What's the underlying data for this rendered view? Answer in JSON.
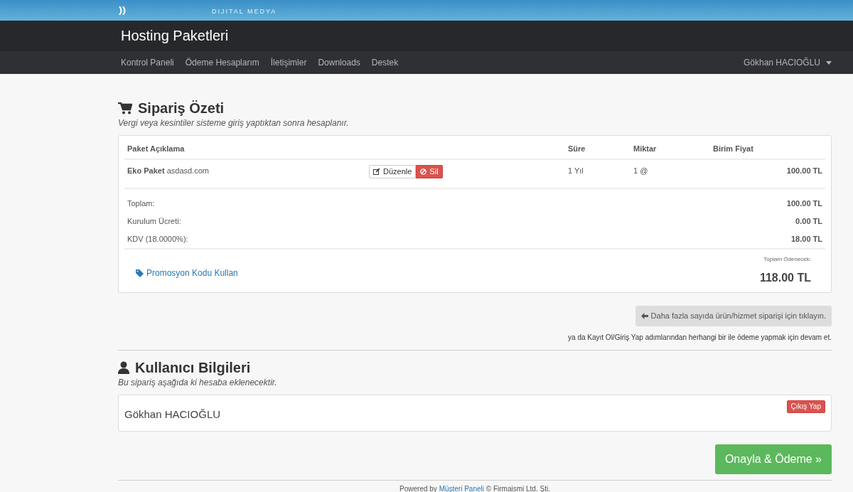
{
  "brand": {
    "tagline": "DIJITAL MEDYA"
  },
  "header": {
    "title": "Hosting Paketleri"
  },
  "nav": {
    "items": [
      {
        "label": "Kontrol Paneli"
      },
      {
        "label": "Ödeme Hesaplarım"
      },
      {
        "label": "İletişimler"
      },
      {
        "label": "Downloads"
      },
      {
        "label": "Destek"
      }
    ],
    "user": "Gökhan HACIOĞLU"
  },
  "order_summary": {
    "title": "Sipariş Özeti",
    "subtitle": "Vergi veya kesintiler sisteme giriş yaptıktan sonra hesaplanır.",
    "columns": [
      "Paket Açıklama",
      "Süre",
      "Miktar",
      "Birim Fiyat"
    ],
    "items": [
      {
        "product": "Eko Paket",
        "domain": "asdasd.com",
        "edit": "Düzenle",
        "delete": "Sil",
        "period": "1 Yıl",
        "quantity": "1 @",
        "price": "100.00 TL"
      }
    ],
    "totals": [
      {
        "label": "Toplam:",
        "value": "100.00 TL"
      },
      {
        "label": "Kurulum Ücreti:",
        "value": "0.00 TL"
      },
      {
        "label": "KDV (18.0000%):",
        "value": "18.00 TL"
      }
    ],
    "promo_link": "Promosyon Kodu Kullan",
    "grand_total_label": "Toplam Ödenecek:",
    "grand_total": "118.00 TL"
  },
  "continue_button": "Daha fazla sayıda ürün/hizmet siparişi için tıklayın.",
  "continue_note": "ya da Kayıt Ol/Giriş Yap adımlarından herhangi bir ile ödeme yapmak için devam et.",
  "user_info": {
    "title": "Kullanıcı Bilgileri",
    "subtitle": "Bu sipariş aşağıda ki hesaba eklenecektir.",
    "name": "Gökhan HACIOĞLU",
    "logout": "Çıkış Yap"
  },
  "checkout_button": "Onayla & Ödeme »",
  "footer": {
    "prefix": "Powered by",
    "link": "Müşteri Paneli",
    "suffix": "© Firmaismi Ltd. Şti."
  }
}
